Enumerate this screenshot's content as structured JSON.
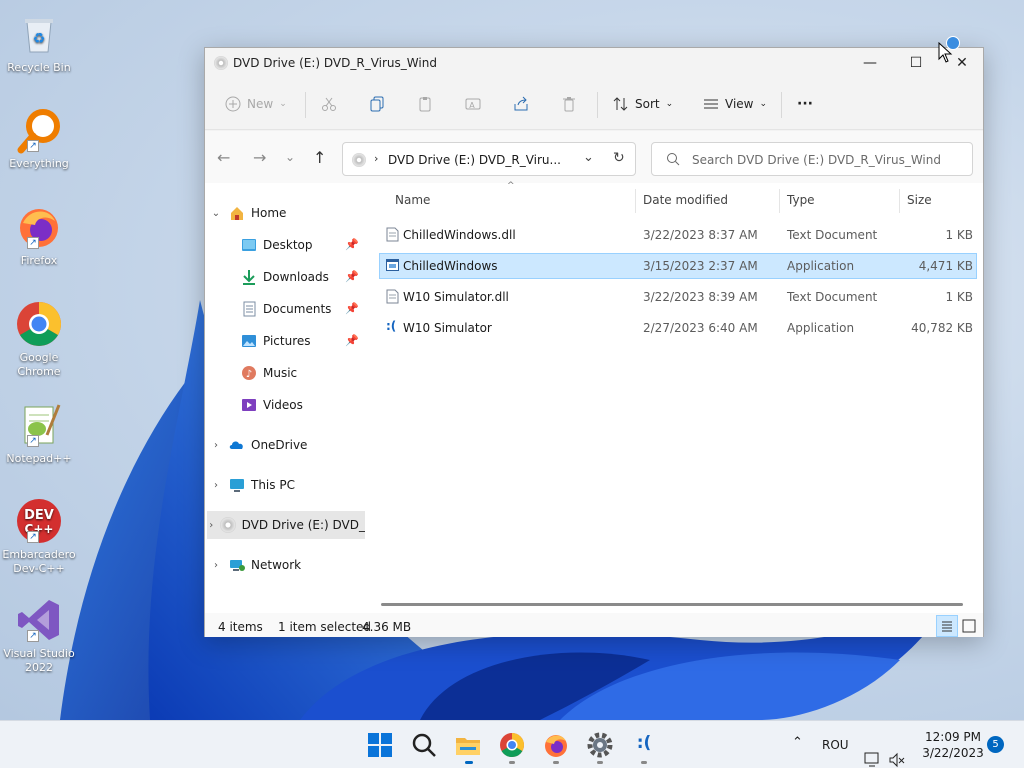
{
  "desktop": {
    "icons": [
      {
        "label": "Recycle Bin"
      },
      {
        "label": "Everything"
      },
      {
        "label": "Firefox"
      },
      {
        "label": "Google Chrome"
      },
      {
        "label": "Notepad++"
      },
      {
        "label": "Embarcadero Dev-C++"
      },
      {
        "label": "Visual Studio 2022"
      }
    ]
  },
  "window": {
    "title": "DVD Drive (E:) DVD_R_Virus_Wind",
    "controls": {
      "minimize": "—",
      "maximize": "☐",
      "close": "✕"
    }
  },
  "cmdbar": {
    "new_label": "New",
    "sort_label": "Sort",
    "view_label": "View",
    "more_label": "···"
  },
  "address": {
    "path": "DVD Drive (E:) DVD_R_Viru...",
    "search_placeholder": "Search DVD Drive (E:) DVD_R_Virus_Wind"
  },
  "nav": {
    "items": [
      {
        "label": "Home"
      },
      {
        "label": "Desktop"
      },
      {
        "label": "Downloads"
      },
      {
        "label": "Documents"
      },
      {
        "label": "Pictures"
      },
      {
        "label": "Music"
      },
      {
        "label": "Videos"
      },
      {
        "label": "OneDrive"
      },
      {
        "label": "This PC"
      },
      {
        "label": "DVD Drive (E:) DVD_"
      },
      {
        "label": "Network"
      }
    ]
  },
  "columns": {
    "name": "Name",
    "date": "Date modified",
    "type": "Type",
    "size": "Size"
  },
  "files": [
    {
      "name": "ChilledWindows.dll",
      "date": "3/22/2023 8:37 AM",
      "type": "Text Document",
      "size": "1 KB"
    },
    {
      "name": "ChilledWindows",
      "date": "3/15/2023 2:37 AM",
      "type": "Application",
      "size": "4,471 KB"
    },
    {
      "name": "W10 Simulator.dll",
      "date": "3/22/2023 8:39 AM",
      "type": "Text Document",
      "size": "1 KB"
    },
    {
      "name": "W10 Simulator",
      "date": "2/27/2023 6:40 AM",
      "type": "Application",
      "size": "40,782 KB"
    }
  ],
  "status": {
    "items": "4 items",
    "selected": "1 item selected",
    "size": "4.36 MB"
  },
  "taskbar": {
    "language": "ROU",
    "time": "12:09 PM",
    "date": "3/22/2023",
    "notification_count": "5",
    "sad_face_label": ":("
  },
  "colors": {
    "accent": "#0067c0",
    "selection": "#cce8ff"
  }
}
